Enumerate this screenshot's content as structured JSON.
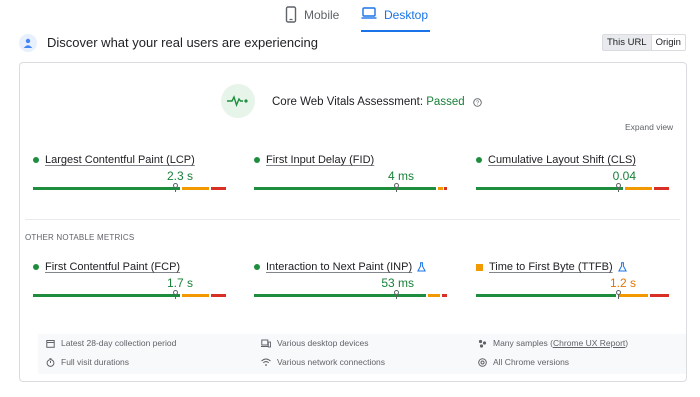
{
  "tabs": {
    "mobile": "Mobile",
    "desktop": "Desktop",
    "selected": "Desktop"
  },
  "header": {
    "title": "Discover what your real users are experiencing"
  },
  "url_toggle": {
    "this_url": "This URL",
    "origin": "Origin",
    "selected": "This URL"
  },
  "assessment": {
    "prefix": "Core Web Vitals Assessment: ",
    "status": "Passed"
  },
  "expand_label": "Expand view",
  "core_metrics": [
    {
      "label": "Largest Contentful Paint (LCP)",
      "value": "2.3 s",
      "status": "good",
      "marker_fraction": 0.74
    },
    {
      "label": "First Input Delay (FID)",
      "value": "4 ms",
      "status": "good",
      "marker_fraction": 0.74
    },
    {
      "label": "Cumulative Layout Shift (CLS)",
      "value": "0.04",
      "status": "good",
      "marker_fraction": 0.74
    }
  ],
  "other_title": "OTHER NOTABLE METRICS",
  "other_metrics": [
    {
      "label": "First Contentful Paint (FCP)",
      "value": "1.7 s",
      "status": "good",
      "experimental": false,
      "marker_fraction": 0.74
    },
    {
      "label": "Interaction to Next Paint (INP)",
      "value": "53 ms",
      "status": "good",
      "experimental": true,
      "marker_fraction": 0.74
    },
    {
      "label": "Time to First Byte (TTFB)",
      "value": "1.2 s",
      "status": "needs-improvement",
      "experimental": true,
      "marker_fraction": 0.74
    }
  ],
  "footer": {
    "collection_period": "Latest 28-day collection period",
    "devices": "Various desktop devices",
    "samples_prefix": "Many samples (",
    "samples_link": "Chrome UX Report",
    "samples_suffix": ")",
    "visit_durations": "Full visit durations",
    "network": "Various network connections",
    "chrome_versions": "All Chrome versions"
  },
  "colors": {
    "good": "#1e8e3e",
    "needs_improvement": "#f29900",
    "poor": "#d93025",
    "accent": "#1a73e8"
  }
}
